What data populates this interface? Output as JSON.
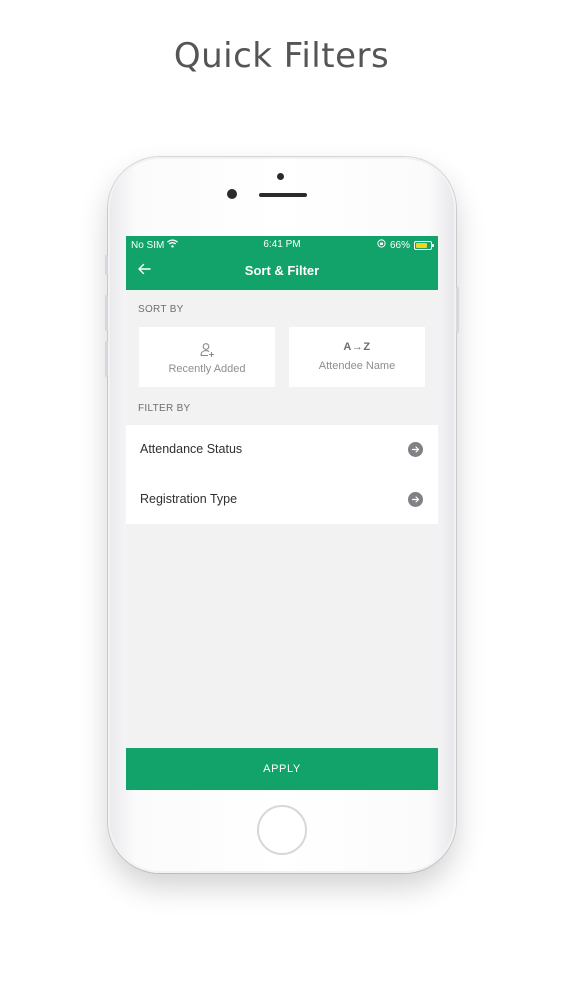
{
  "headline": "Quick Filters",
  "status_bar": {
    "carrier": "No SIM",
    "wifi_icon": "wifi-icon",
    "time": "6:41 PM",
    "orientation_lock_icon": "orientation-lock-icon",
    "battery_percent": "66%",
    "battery_level": 0.66
  },
  "navbar": {
    "back_icon": "arrow-left-icon",
    "title": "Sort & Filter"
  },
  "sort": {
    "section_label": "SORT BY",
    "options": [
      {
        "icon": "add-person-icon",
        "label": "Recently Added"
      },
      {
        "glyph": "A→Z",
        "label": "Attendee Name"
      }
    ]
  },
  "filter": {
    "section_label": "FILTER BY",
    "items": [
      {
        "label": "Attendance Status",
        "icon": "chevron-right-circle-icon"
      },
      {
        "label": "Registration Type",
        "icon": "chevron-right-circle-icon"
      }
    ]
  },
  "apply_label": "APPLY",
  "colors": {
    "brand_green": "#12a36a",
    "screen_bg": "#f2f2f3",
    "battery_fill": "#f7d21c"
  }
}
